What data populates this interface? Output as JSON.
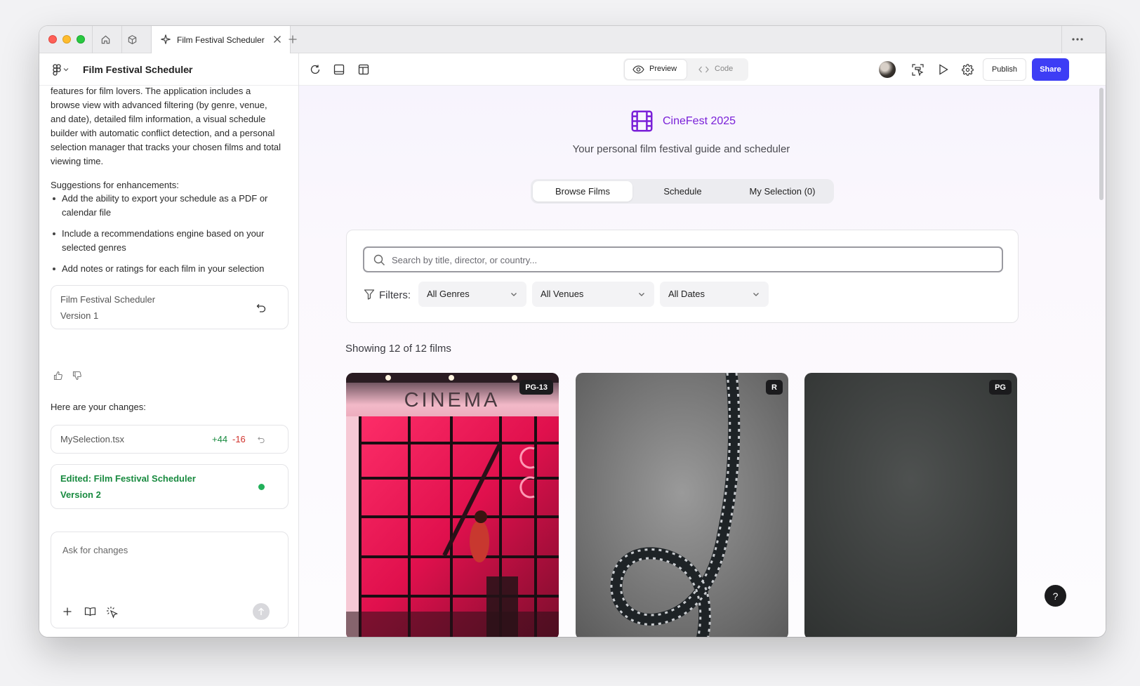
{
  "browser": {
    "tab_title": "Film Festival Scheduler",
    "icons": [
      "home-icon",
      "cube-icon",
      "sparkle-icon",
      "close-icon",
      "plus-icon",
      "more-icon"
    ]
  },
  "left_panel": {
    "project_title": "Film Festival Scheduler",
    "intro_text": "features for film lovers. The application includes a browse view with advanced filtering (by genre, venue, and date), detailed film information, a visual schedule builder with automatic conflict detection, and a personal selection manager that tracks your chosen films and total viewing time.",
    "suggestions_heading": "Suggestions for enhancements:",
    "suggestions": [
      "Add the ability to export your schedule as a PDF or calendar file",
      "Include a recommendations engine based on your selected genres",
      "Add notes or ratings for each film in your selection"
    ],
    "version_card": {
      "title": "Film Festival Scheduler",
      "version": "Version 1"
    },
    "changes_heading": "Here are your changes:",
    "file_change": {
      "file": "MySelection.tsx",
      "added": "+44",
      "removed": "-16"
    },
    "edited_card": {
      "title": "Edited: Film Festival Scheduler",
      "version": "Version 2"
    },
    "ask_placeholder": "Ask for changes"
  },
  "toolbar": {
    "preview_label": "Preview",
    "code_label": "Code",
    "publish_label": "Publish",
    "share_label": "Share"
  },
  "app": {
    "brand_name": "CineFest 2025",
    "subtitle": "Your personal film festival guide and scheduler",
    "tabs": [
      "Browse Films",
      "Schedule",
      "My Selection (0)"
    ],
    "active_tab": 0,
    "search_placeholder": "Search by title, director, or country...",
    "filters_label": "Filters:",
    "filter_selects": [
      "All Genres",
      "All Venues",
      "All Dates"
    ],
    "showing_text": "Showing 12 of 12 films",
    "films": [
      {
        "rating": "PG-13",
        "image": "cinema-neon-photo",
        "sign_text": "CINEMA"
      },
      {
        "rating": "R",
        "image": "film-strip-photo"
      },
      {
        "rating": "PG",
        "image": "dark-texture-photo"
      }
    ],
    "help_label": "?"
  },
  "colors": {
    "accent_blue": "#3d3df5",
    "brand_purple": "#7a20d8",
    "added_green": "#188a3f",
    "removed_red": "#d1322c"
  }
}
